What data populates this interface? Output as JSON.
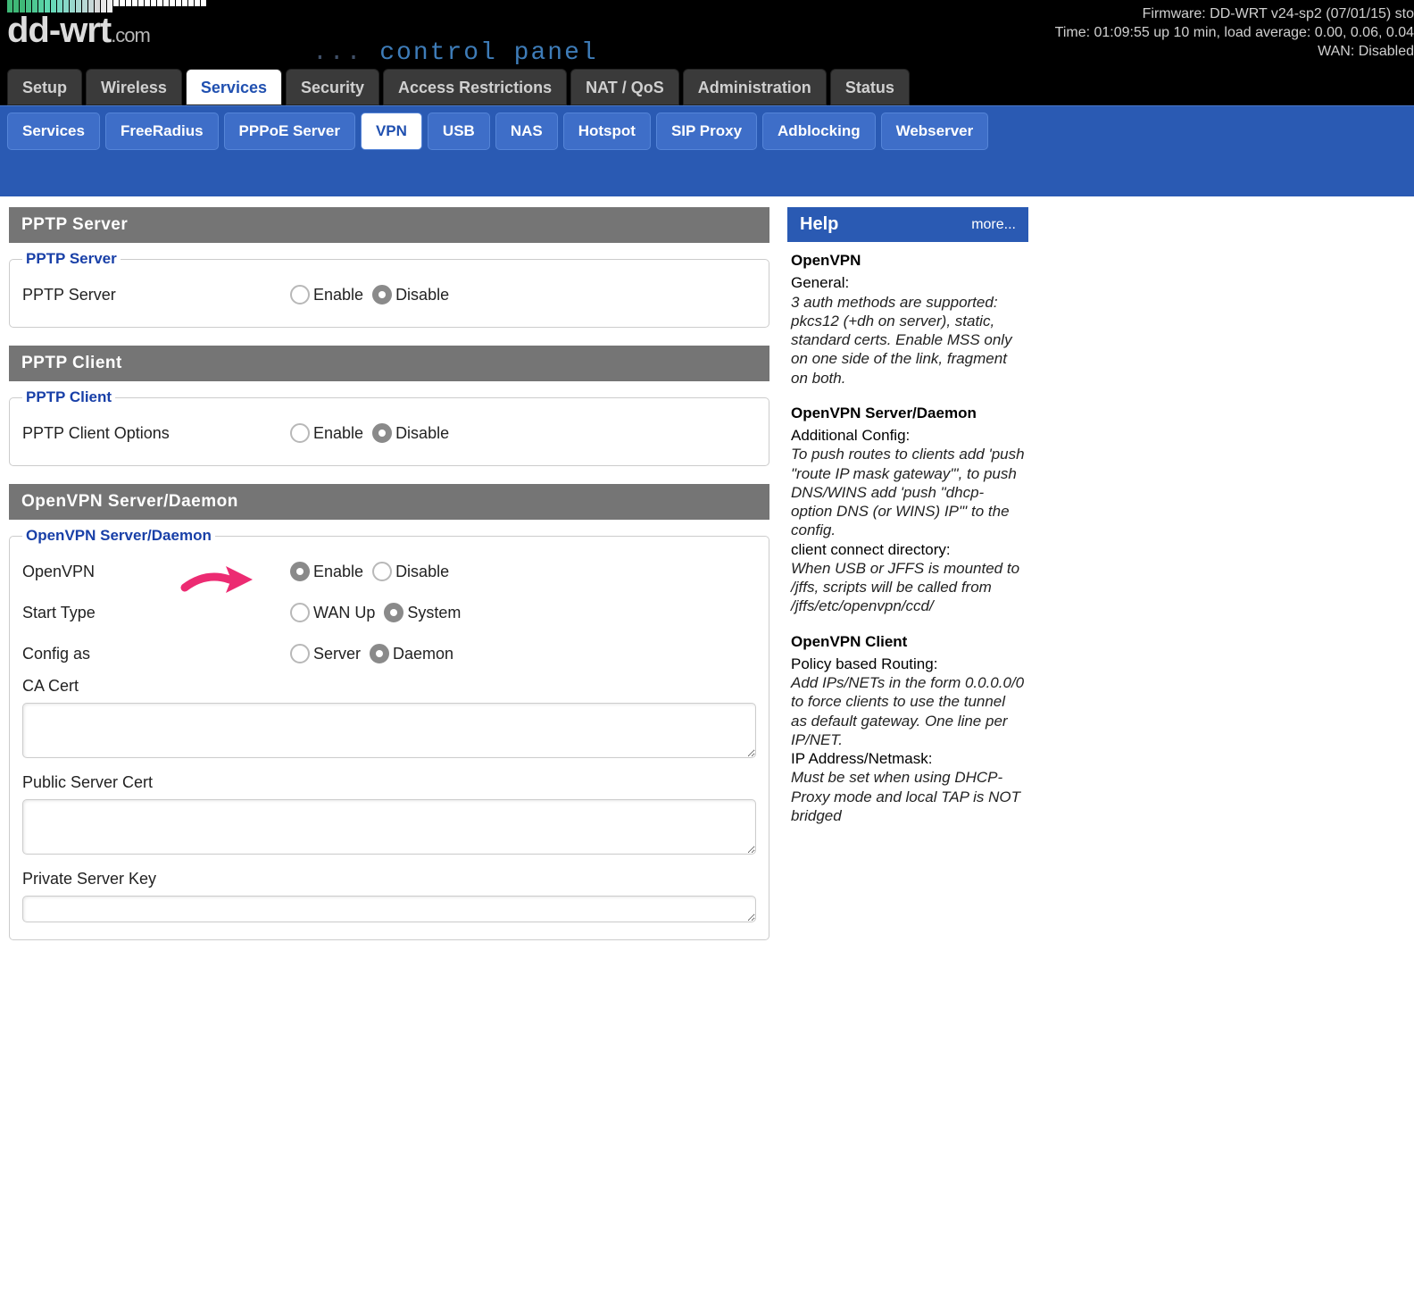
{
  "header": {
    "logo_main": "dd-wrt",
    "logo_sub": ".com",
    "cp_dots": "...",
    "cp_text": "control panel",
    "firmware": "Firmware: DD-WRT v24-sp2 (07/01/15) sto",
    "time": "Time: 01:09:55 up 10 min, load average: 0.00, 0.06, 0.04",
    "wan": "WAN: Disabled"
  },
  "main_tabs": [
    {
      "label": "Setup",
      "active": false
    },
    {
      "label": "Wireless",
      "active": false
    },
    {
      "label": "Services",
      "active": true
    },
    {
      "label": "Security",
      "active": false
    },
    {
      "label": "Access Restrictions",
      "active": false
    },
    {
      "label": "NAT / QoS",
      "active": false
    },
    {
      "label": "Administration",
      "active": false
    },
    {
      "label": "Status",
      "active": false
    }
  ],
  "sub_tabs": [
    {
      "label": "Services",
      "active": false
    },
    {
      "label": "FreeRadius",
      "active": false
    },
    {
      "label": "PPPoE Server",
      "active": false
    },
    {
      "label": "VPN",
      "active": true
    },
    {
      "label": "USB",
      "active": false
    },
    {
      "label": "NAS",
      "active": false
    },
    {
      "label": "Hotspot",
      "active": false
    },
    {
      "label": "SIP Proxy",
      "active": false
    },
    {
      "label": "Adblocking",
      "active": false
    },
    {
      "label": "Webserver",
      "active": false
    }
  ],
  "sections": {
    "pptp_server": {
      "header": "PPTP Server",
      "legend": "PPTP Server",
      "row_label": "PPTP Server",
      "enable": "Enable",
      "disable": "Disable",
      "value": "disable"
    },
    "pptp_client": {
      "header": "PPTP Client",
      "legend": "PPTP Client",
      "row_label": "PPTP Client Options",
      "enable": "Enable",
      "disable": "Disable",
      "value": "disable"
    },
    "openvpn": {
      "header": "OpenVPN Server/Daemon",
      "legend": "OpenVPN Server/Daemon",
      "rows": {
        "openvpn": {
          "label": "OpenVPN",
          "opt1": "Enable",
          "opt2": "Disable",
          "value": "enable"
        },
        "start_type": {
          "label": "Start Type",
          "opt1": "WAN Up",
          "opt2": "System",
          "value": "system"
        },
        "config_as": {
          "label": "Config as",
          "opt1": "Server",
          "opt2": "Daemon",
          "value": "daemon"
        }
      },
      "ca_cert": "CA Cert",
      "pub_cert": "Public Server Cert",
      "priv_key": "Private Server Key"
    }
  },
  "help": {
    "title": "Help",
    "more": "more...",
    "sections": [
      {
        "heading": "OpenVPN",
        "sub": "General:",
        "text": "3 auth methods are supported: pkcs12 (+dh on server), static, standard certs. Enable MSS only on one side of the link, fragment on both."
      },
      {
        "heading": "OpenVPN Server/Daemon",
        "sub": "Additional Config:",
        "text": "To push routes to clients add 'push \"route IP mask gateway\"', to push DNS/WINS add 'push \"dhcp-option DNS (or WINS) IP\"' to the config.",
        "sub2": "client connect directory:",
        "text2": "When USB or JFFS is mounted to /jffs, scripts will be called from /jffs/etc/openvpn/ccd/"
      },
      {
        "heading": "OpenVPN Client",
        "sub": "Policy based Routing:",
        "text": "Add IPs/NETs in the form 0.0.0.0/0 to force clients to use the tunnel as default gateway. One line per IP/NET.",
        "sub2": "IP Address/Netmask:",
        "text2": "Must be set when using DHCP-Proxy mode and local TAP is NOT bridged"
      }
    ]
  }
}
